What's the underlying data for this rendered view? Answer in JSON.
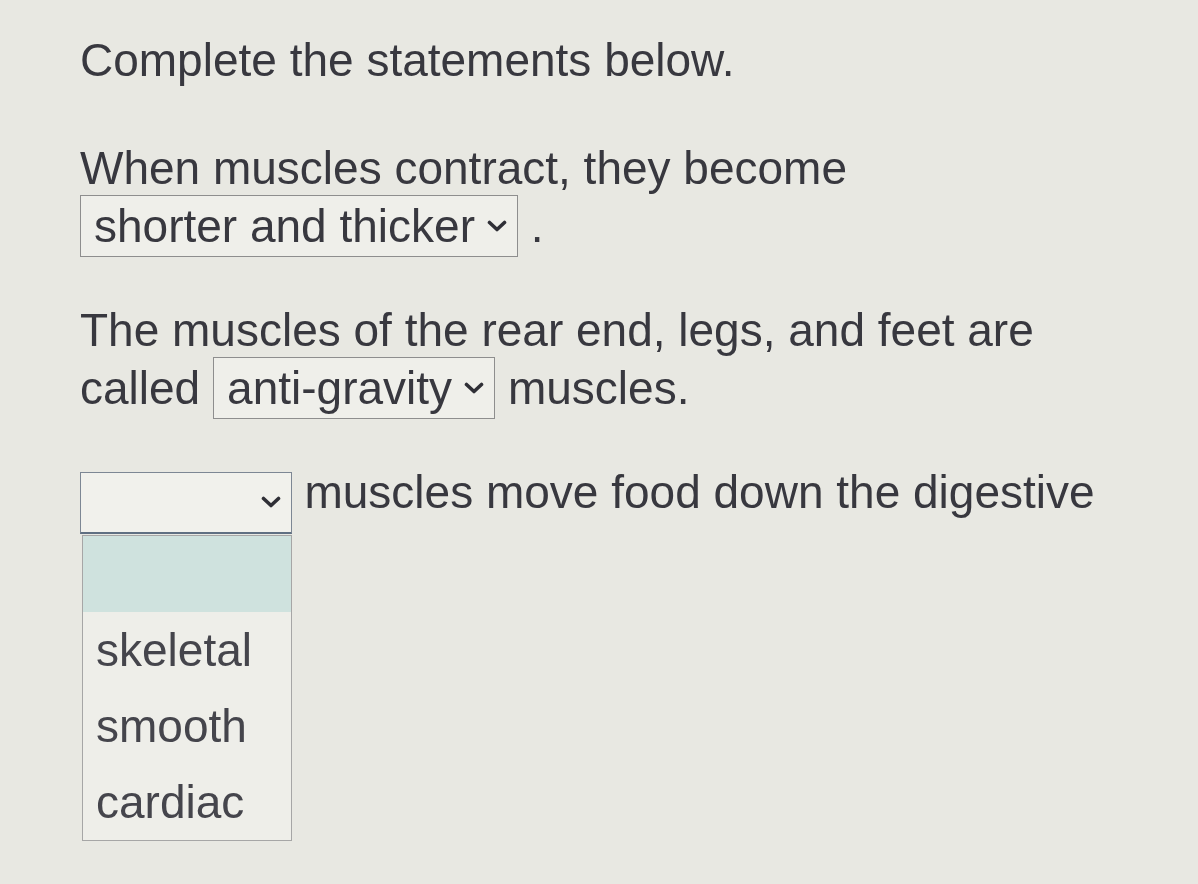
{
  "title": "Complete the statements below.",
  "statements": [
    {
      "parts": [
        {
          "kind": "text",
          "text": "When muscles contract, they become"
        },
        {
          "kind": "select",
          "value": "shorter and thicker",
          "open": false
        },
        {
          "kind": "text",
          "text": "."
        }
      ]
    },
    {
      "parts": [
        {
          "kind": "text",
          "text": "The muscles of the rear end, legs, and feet are"
        },
        {
          "kind": "text",
          "text": "called"
        },
        {
          "kind": "select",
          "value": "anti-gravity",
          "open": false
        },
        {
          "kind": "text",
          "text": "muscles."
        }
      ]
    },
    {
      "parts": [
        {
          "kind": "select",
          "open": true,
          "options": [
            {
              "selected": true
            },
            {
              "label": "skeletal",
              "selected": false
            },
            {
              "label": "smooth",
              "selected": false
            },
            {
              "label": "cardiac",
              "selected": false
            }
          ]
        },
        {
          "kind": "text",
          "text": "muscles move food down the digestive"
        }
      ]
    }
  ]
}
